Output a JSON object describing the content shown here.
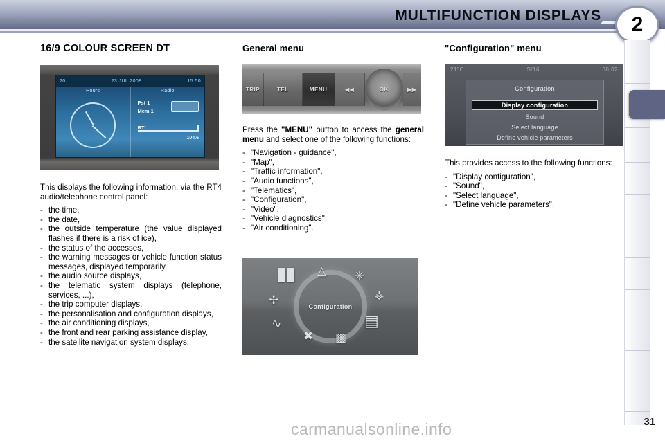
{
  "header": {
    "title": "MULTIFUNCTION DISPLAYS",
    "chapter_number": "2",
    "accent_color": "#5f6384",
    "bar_gradient_top": "#ccd1e0",
    "bar_gradient_bottom": "#646b86"
  },
  "columns": {
    "left": {
      "heading": "16/9 COLOUR SCREEN DT",
      "intro": "This displays the following information, via the RT4 audio/telephone control panel:",
      "items": [
        "the time,",
        "the date,",
        "the outside temperature (the value displayed flashes if there is a risk of ice),",
        "the status of the accesses,",
        "the warning messages or vehicle function status messages, displayed temporarily,",
        "the audio source displays,",
        "the telematic system displays (telephone, services, ...),",
        "the trip computer displays,",
        "the personalisation and configuration displays,",
        "the air conditioning displays,",
        "the front and rear parking assistance display,",
        "the satellite navigation system displays."
      ],
      "photo": {
        "name": "16-9-colour-screen-photo",
        "status_bar": {
          "temperature": "20",
          "date": "23 JUL 2008",
          "time": "15:50"
        },
        "left_pane_title": "Hours",
        "right_pane_title": "Radio",
        "radio_lines": [
          "Pst 1",
          "Mem 1"
        ],
        "radio_station": "RTL",
        "radio_frequency": "104.6"
      }
    },
    "middle": {
      "heading": "General menu",
      "intro_prefix": "Press the ",
      "intro_bold1": "\"MENU\"",
      "intro_mid": " button to access the ",
      "intro_bold2": "general menu",
      "intro_suffix": " and select one of the following functions:",
      "items": [
        "\"Navigation - guidance\",",
        "\"Map\",",
        "\"Traffic information\",",
        "\"Audio functions\",",
        "\"Telematics\",",
        "\"Configuration\",",
        "\"Video\",",
        "\"Vehicle diagnostics\",",
        "\"Air conditioning\"."
      ],
      "panel_photo": {
        "name": "control-panel-photo",
        "buttons": [
          "TRIP",
          "TEL",
          "MENU",
          "◀◀",
          "OK",
          "▶▶"
        ],
        "highlighted_button": "MENU"
      },
      "wheel_photo": {
        "name": "configuration-wheel-photo",
        "center_label": "Configuration",
        "icons": [
          "seats-icon",
          "warning-triangle-icon",
          "vehicle-icon",
          "lighting-icon",
          "key-icon",
          "wiper-icon",
          "display-panel-icon",
          "tools-icon",
          "camera-icon"
        ]
      }
    },
    "right": {
      "heading": "\"Configuration\" menu",
      "intro": "This provides access to the following functions:",
      "items": [
        "\"Display configuration\",",
        "\"Sound\",",
        "\"Select language\",",
        "\"Define vehicle parameters\"."
      ],
      "photo": {
        "name": "configuration-menu-screen-photo",
        "status_left": "21°C",
        "status_center": "S/16",
        "status_right": "08:02",
        "dialog_title": "Configuration",
        "menu_items": [
          "Display configuration",
          "Sound",
          "Select language",
          "Define vehicle parameters"
        ],
        "selected_item": "Display configuration"
      }
    }
  },
  "footer": {
    "watermark": "carmanualsonline.info",
    "page_number": "31"
  }
}
